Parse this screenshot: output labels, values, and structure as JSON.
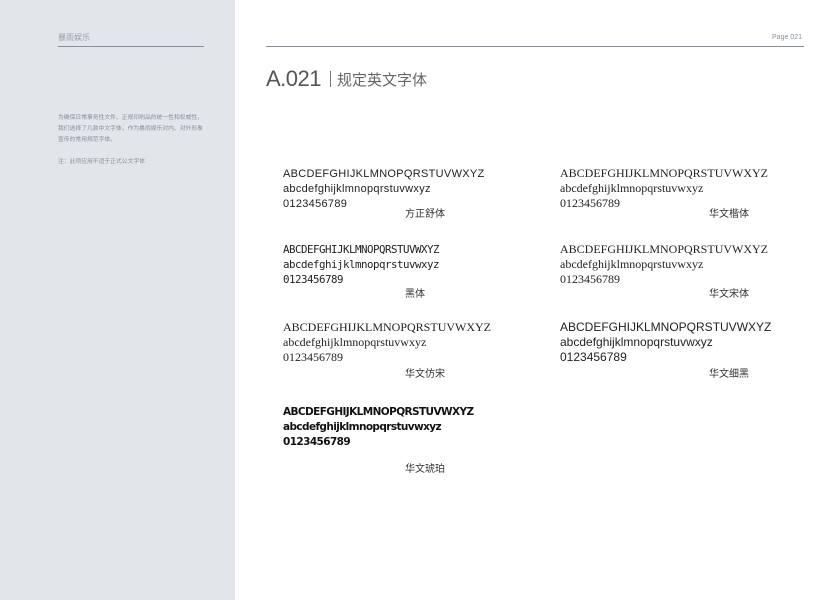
{
  "sidebar": {
    "brand": "暴雨娱乐",
    "intro": "为确保日常事务性文件、正规印刷品的统一性和权威性，我们选择了几款中文字体，作为暴雨娱乐对内、对外形象宣传的常用规范字体。",
    "note": "注：此项应用不适于正式公文字体"
  },
  "header": {
    "page_label": "Page 021",
    "code": "A.021",
    "title": "规定英文字体"
  },
  "samples": [
    {
      "uppercase": "ABCDEFGHIJKLMNOPQRSTUVWXYZ",
      "lowercase": "abcdefghijklmnopqrstuvwxyz",
      "digits": "0123456789",
      "font_name": "方正舒体"
    },
    {
      "uppercase": "ABCDEFGHIJKLMNOPQRSTUVWXYZ",
      "lowercase": "abcdefghijklmnopqrstuvwxyz",
      "digits": "0123456789",
      "font_name": "华文楷体"
    },
    {
      "uppercase": "ABCDEFGHIJKLMNOPQRSTUVWXYZ",
      "lowercase": "abcdefghijklmnopqrstuvwxyz",
      "digits": "0123456789",
      "font_name": "黑体"
    },
    {
      "uppercase": "ABCDEFGHIJKLMNOPQRSTUVWXYZ",
      "lowercase": "abcdefghijklmnopqrstuvwxyz",
      "digits": "0123456789",
      "font_name": "华文宋体"
    },
    {
      "uppercase": "ABCDEFGHIJKLMNOPQRSTUVWXYZ",
      "lowercase": "abcdefghijklmnopqrstuvwxyz",
      "digits": "0123456789",
      "font_name": "华文仿宋"
    },
    {
      "uppercase": "ABCDEFGHIJKLMNOPQRSTUVWXYZ",
      "lowercase": "abcdefghijklmnopqrstuvwxyz",
      "digits": "0123456789",
      "font_name": "华文细黑"
    },
    {
      "uppercase": "ABCDEFGHIJKLMNOPQRSTUVWXYZ",
      "lowercase": "abcdefghijklmnopqrstuvwxyz",
      "digits": "0123456789",
      "font_name": "华文琥珀"
    }
  ]
}
